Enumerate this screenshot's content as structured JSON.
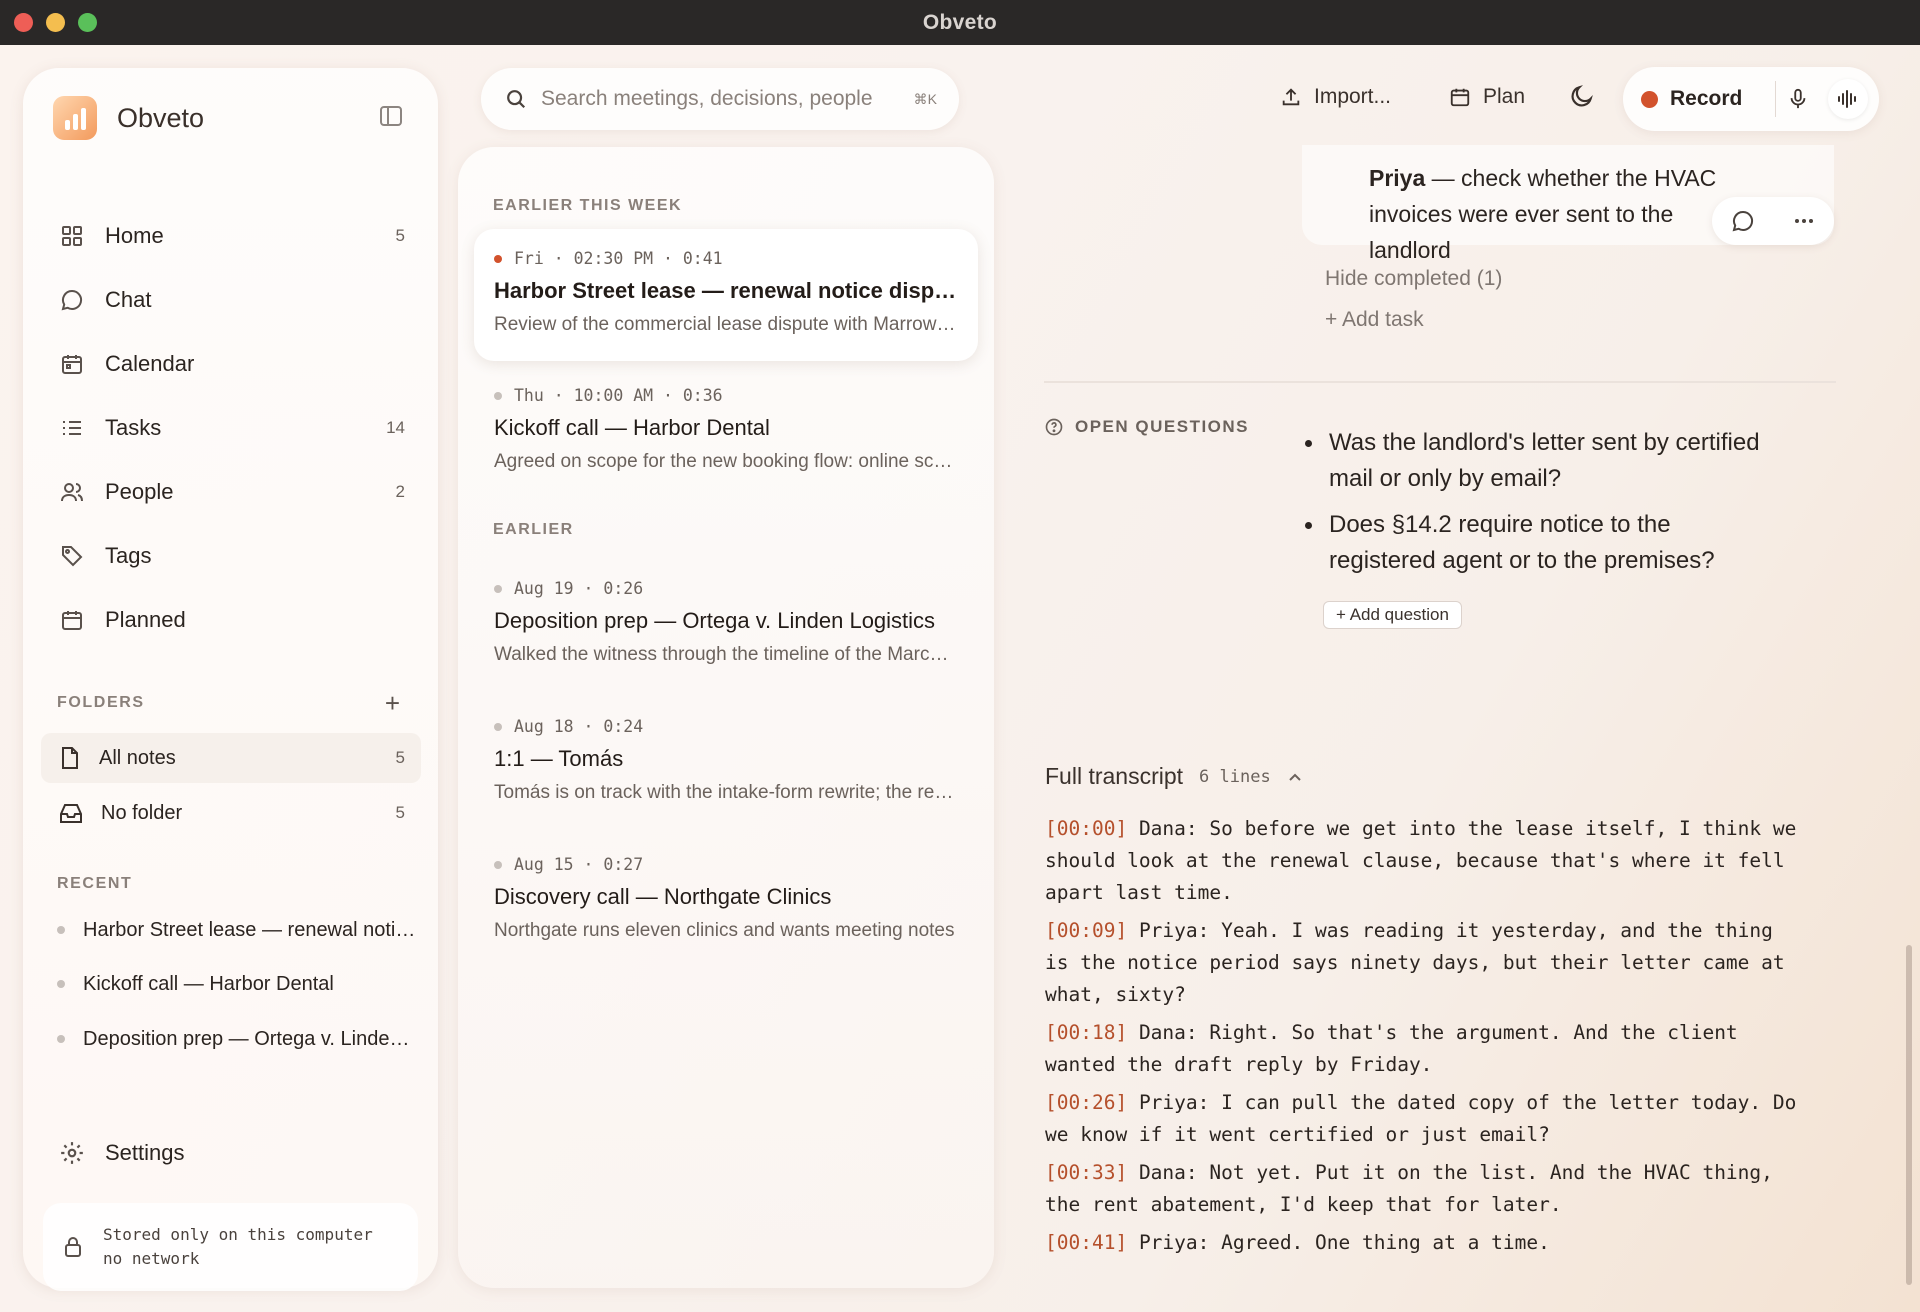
{
  "window": {
    "title": "Obveto"
  },
  "brand": {
    "name": "Obveto"
  },
  "nav": [
    {
      "label": "Home",
      "count": "5",
      "icon": "grid-icon"
    },
    {
      "label": "Chat",
      "count": "",
      "icon": "chat-bubble-icon"
    },
    {
      "label": "Calendar",
      "count": "",
      "icon": "calendar-icon"
    },
    {
      "label": "Tasks",
      "count": "14",
      "icon": "list-icon"
    },
    {
      "label": "People",
      "count": "2",
      "icon": "people-icon"
    },
    {
      "label": "Tags",
      "count": "",
      "icon": "tag-icon"
    },
    {
      "label": "Planned",
      "count": "",
      "icon": "calendar-planned-icon"
    }
  ],
  "folders": {
    "heading": "FOLDERS",
    "items": [
      {
        "label": "All notes",
        "count": "5",
        "icon": "document-icon"
      },
      {
        "label": "No folder",
        "count": "5",
        "icon": "inbox-icon"
      }
    ]
  },
  "recent": {
    "heading": "RECENT",
    "items": [
      {
        "label": "Harbor Street lease — renewal notice dispute"
      },
      {
        "label": "Kickoff call — Harbor Dental"
      },
      {
        "label": "Deposition prep — Ortega v. Linden Logistics"
      }
    ]
  },
  "settings": {
    "label": "Settings"
  },
  "storage": {
    "line1": "Stored only on this computer",
    "line2": "no network"
  },
  "search": {
    "placeholder": "Search meetings, decisions, people",
    "shortcut": "⌘K"
  },
  "toolbar": {
    "import_label": "Import...",
    "plan_label": "Plan",
    "record_label": "Record"
  },
  "list": {
    "groups": [
      {
        "heading": "EARLIER THIS WEEK",
        "meetings": [
          {
            "meta": "Fri · 02:30 PM · 0:41",
            "title": "Harbor Street lease — renewal notice dispute",
            "snippet": "Review of the commercial lease dispute with Marrow Holdings",
            "selected": true
          },
          {
            "meta": "Thu · 10:00 AM · 0:36",
            "title": "Kickoff call — Harbor Dental",
            "snippet": "Agreed on scope for the new booking flow: online scheduling"
          }
        ]
      },
      {
        "heading": "EARLIER",
        "meetings": [
          {
            "meta": "Aug 19 · 0:26",
            "title": "Deposition prep — Ortega v. Linden Logistics",
            "snippet": "Walked the witness through the timeline of the March incident"
          },
          {
            "meta": "Aug 18 · 0:24",
            "title": "1:1 — Tomás",
            "snippet": "Tomás is on track with the intake-form rewrite; the review"
          },
          {
            "meta": "Aug 15 · 0:27",
            "title": "Discovery call — Northgate Clinics",
            "snippet": "Northgate runs eleven clinics and wants meeting notes"
          }
        ]
      }
    ]
  },
  "detail": {
    "task": {
      "assignee": "Priya",
      "text": "check whether the HVAC invoices were ever sent to the landlord"
    },
    "hide_completed": "Hide completed (1)",
    "add_task": "+ Add task",
    "open_questions": {
      "heading": "OPEN QUESTIONS",
      "items": [
        "Was the landlord's letter sent by certified mail or only by email?",
        "Does §14.2 require notice to the registered agent or to the premises?"
      ],
      "add_label": "+ Add question"
    },
    "transcript": {
      "title": "Full transcript",
      "count": "6 lines",
      "lines": [
        {
          "ts": "[00:00]",
          "text": "Dana: So before we get into the lease itself, I think we should look at the renewal clause, because that's where it fell apart last time."
        },
        {
          "ts": "[00:09]",
          "text": "Priya: Yeah. I was reading it yesterday, and the thing is the notice period says ninety days, but their letter came at what, sixty?"
        },
        {
          "ts": "[00:18]",
          "text": "Dana: Right. So that's the argument. And the client wanted the draft reply by Friday."
        },
        {
          "ts": "[00:26]",
          "text": "Priya: I can pull the dated copy of the letter today. Do we know if it went certified or just email?"
        },
        {
          "ts": "[00:33]",
          "text": "Dana: Not yet. Put it on the list. And the HVAC thing, the rent abatement, I'd keep that for later."
        },
        {
          "ts": "[00:41]",
          "text": "Priya: Agreed. One thing at a time."
        }
      ]
    }
  }
}
